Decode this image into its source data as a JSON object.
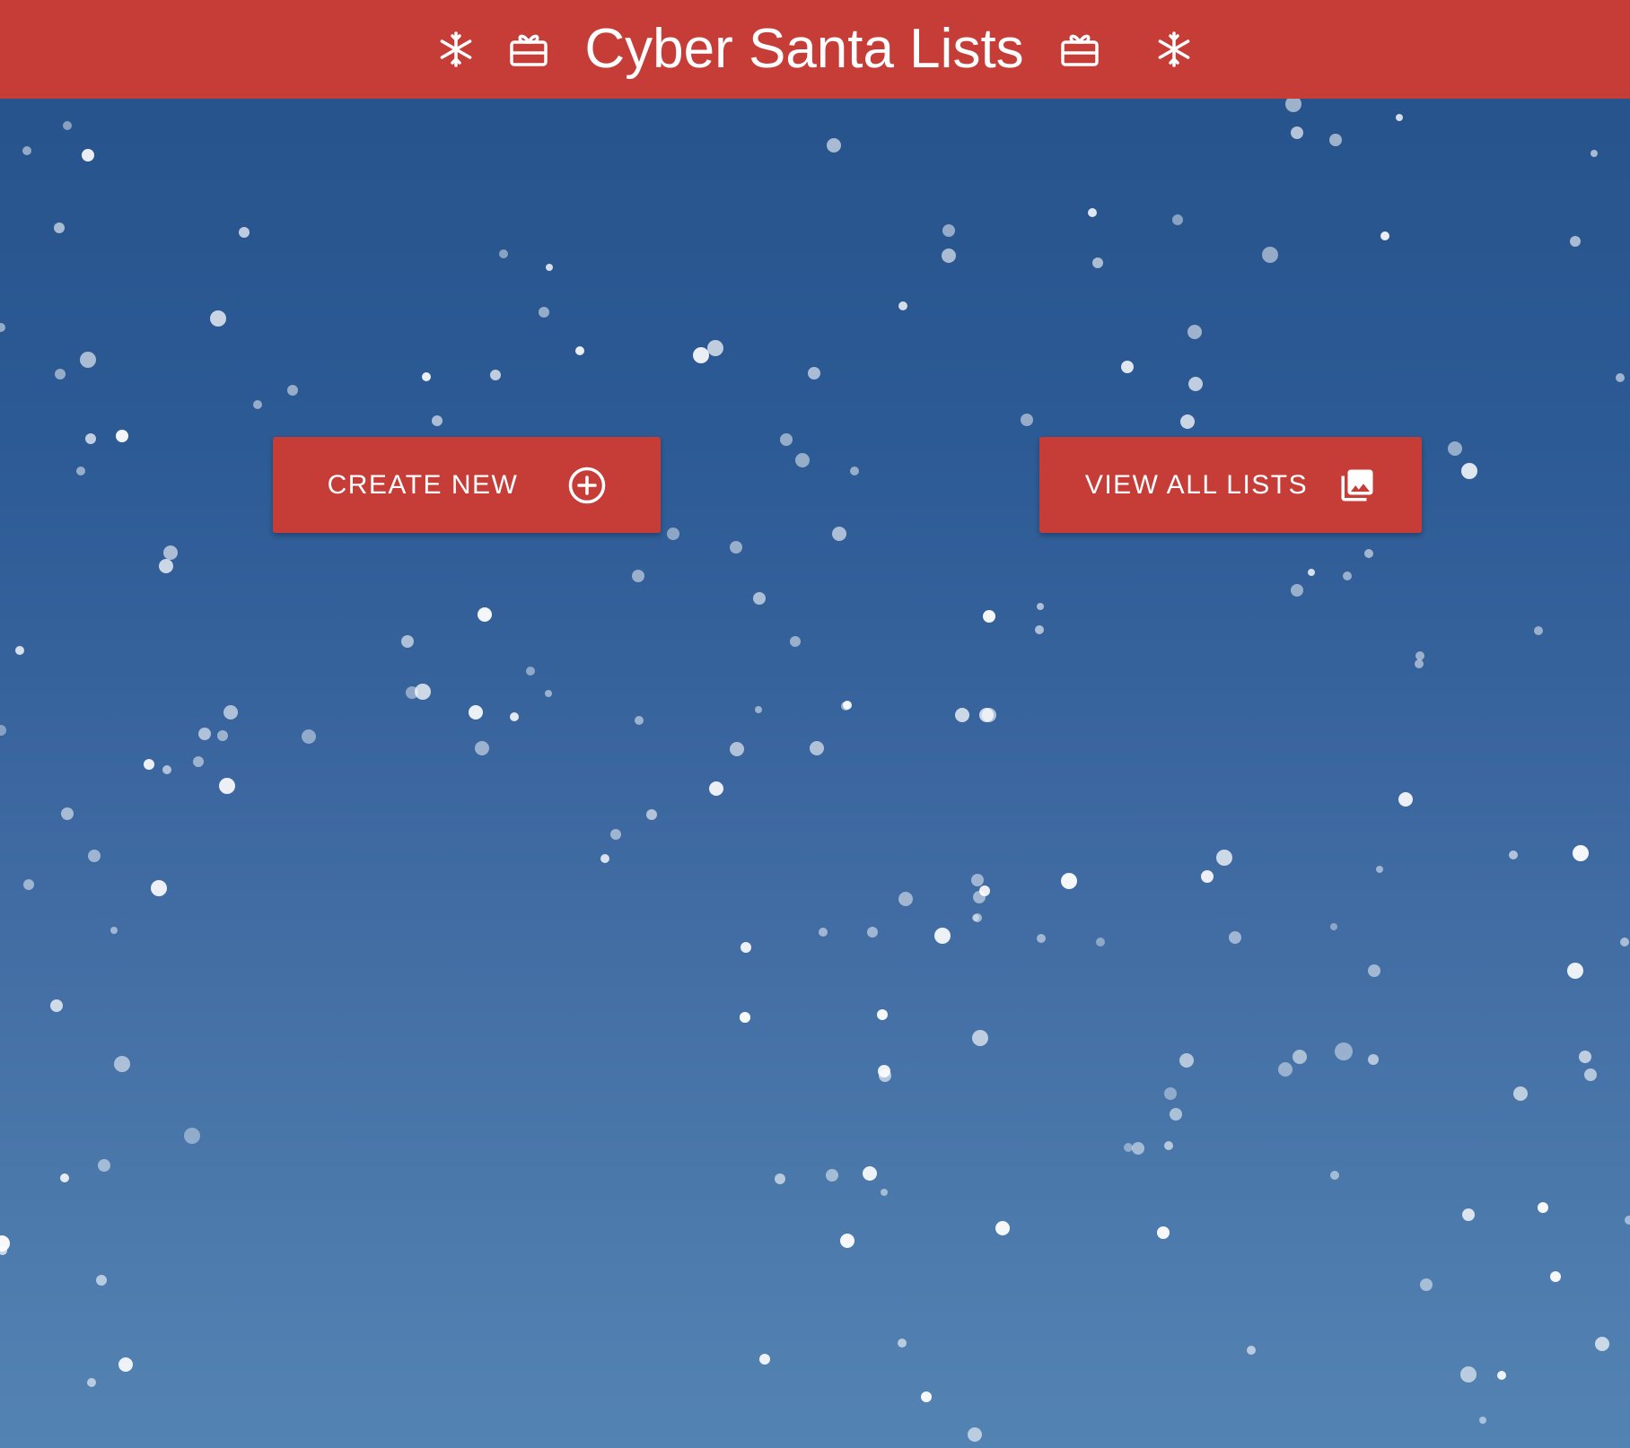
{
  "header": {
    "title": "Cyber Santa Lists",
    "icons": [
      "snowflake-icon",
      "gift-icon",
      "gift-icon",
      "snowflake-icon"
    ]
  },
  "actions": {
    "create_new": {
      "label": "CREATE NEW",
      "icon": "add-circle-icon"
    },
    "view_all": {
      "label": "VIEW ALL LISTS",
      "icon": "photo-library-icon"
    }
  },
  "colors": {
    "header_bg": "#c63d38",
    "button_bg": "#c63d38",
    "background_top": "#27528b",
    "background_bottom": "#5383b3",
    "text": "#ffffff",
    "snow": "#ffffff"
  }
}
